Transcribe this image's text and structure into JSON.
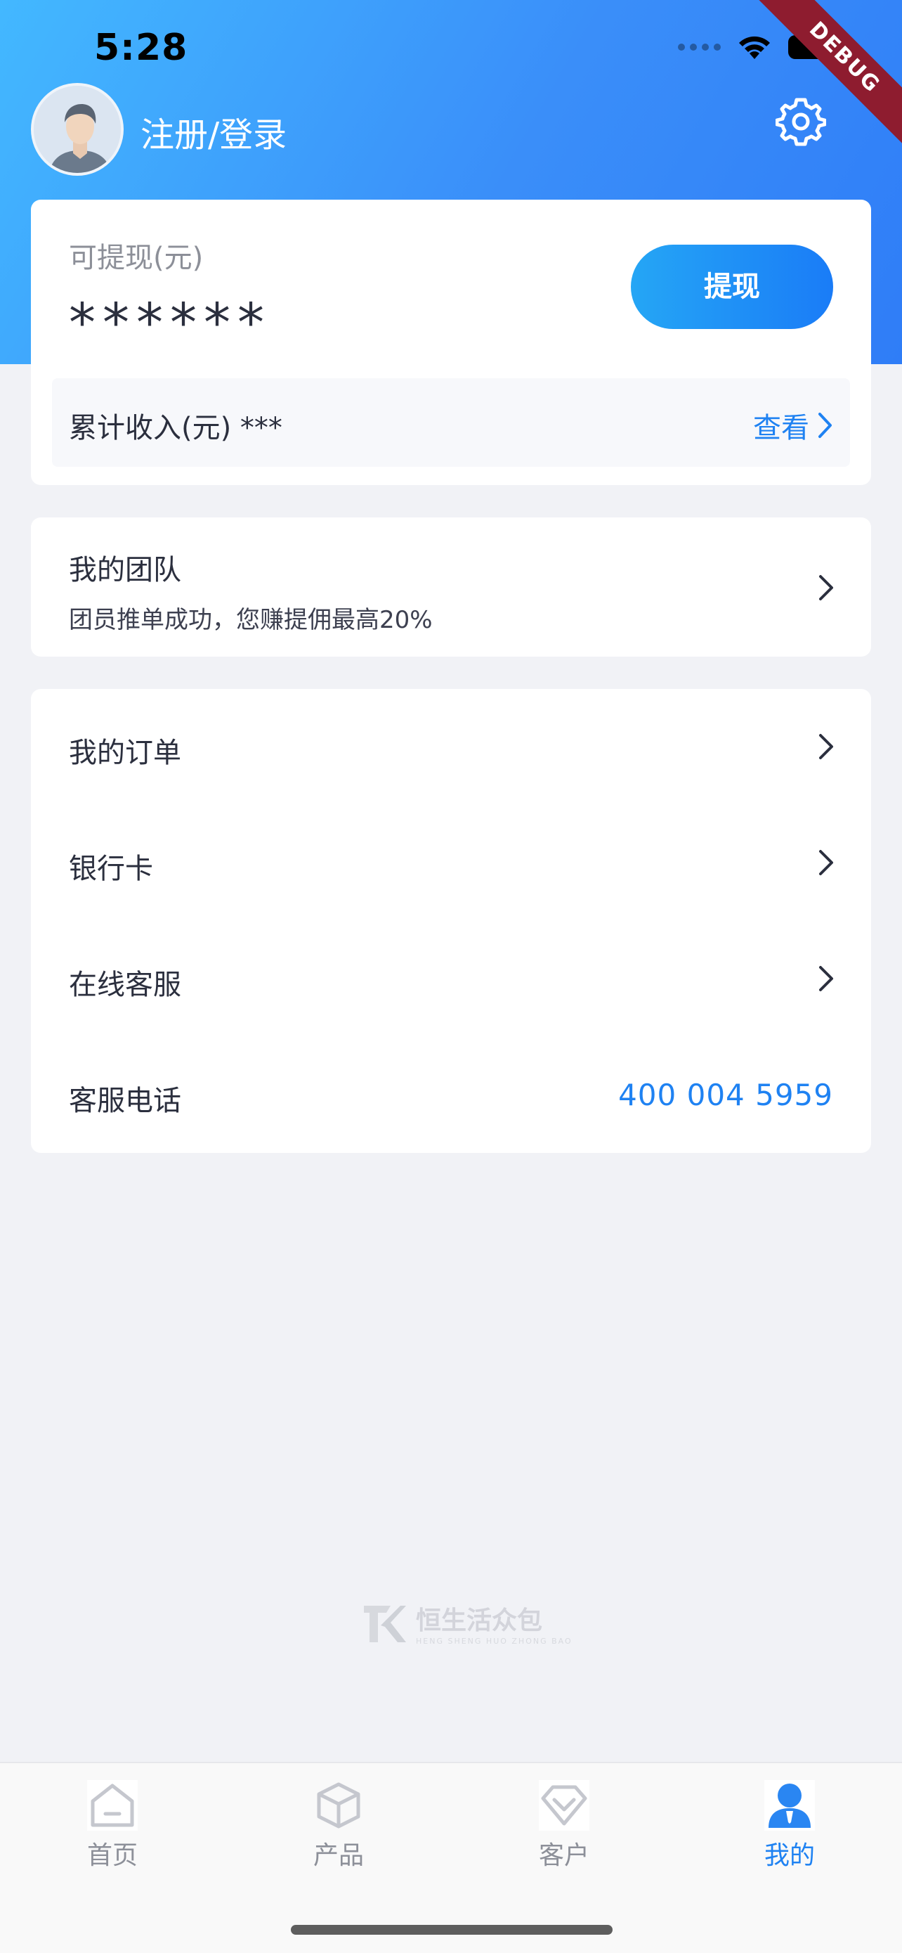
{
  "status_bar": {
    "time": "5:28"
  },
  "debug_ribbon": "DEBUG",
  "header": {
    "login_label": "注册/登录"
  },
  "balance_card": {
    "label": "可提现(元)",
    "value": "******",
    "withdraw_button": "提现",
    "income_label": "累计收入(元) ***",
    "view_link": "查看"
  },
  "team_card": {
    "title": "我的团队",
    "subtitle": "团员推单成功，您赚提佣最高20%"
  },
  "menu": {
    "items": [
      {
        "label": "我的订单"
      },
      {
        "label": "银行卡"
      },
      {
        "label": "在线客服"
      }
    ],
    "phone_label": "客服电话",
    "phone_number": "400 004 5959"
  },
  "watermark": {
    "name": "恒生活众包",
    "sub": "HENG SHENG HUO ZHONG BAO"
  },
  "tabbar": {
    "items": [
      {
        "label": "首页",
        "icon": "home-icon",
        "active": false
      },
      {
        "label": "产品",
        "icon": "cube-icon",
        "active": false
      },
      {
        "label": "客户",
        "icon": "diamond-icon",
        "active": false
      },
      {
        "label": "我的",
        "icon": "person-icon",
        "active": true
      }
    ]
  },
  "colors": {
    "accent": "#1f82f2",
    "hero_start": "#43b8ff",
    "hero_end": "#2f7df7",
    "background": "#f1f2f6",
    "debug": "#8e1c2f"
  }
}
